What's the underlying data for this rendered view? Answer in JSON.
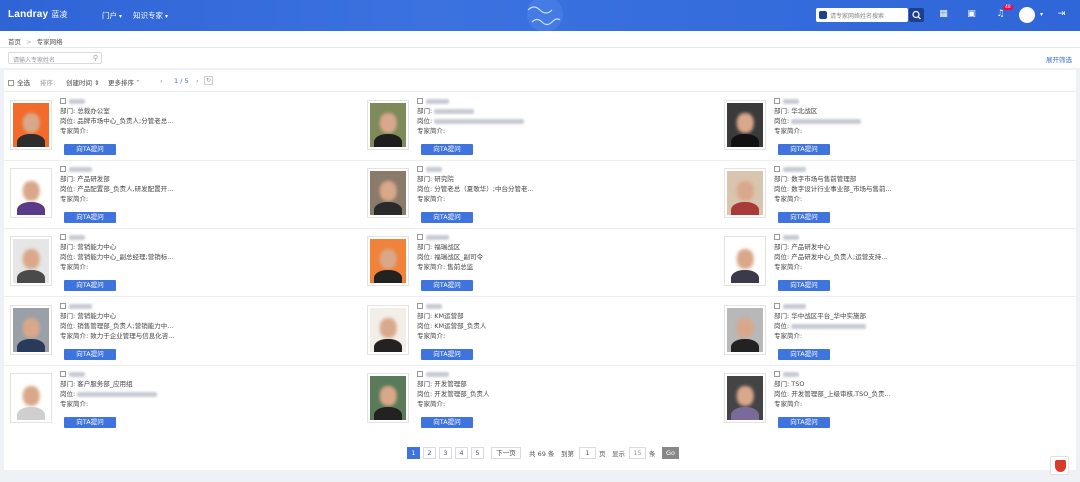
{
  "header": {
    "brand": "Landray",
    "brand_cn": "蓝凌",
    "nav": [
      {
        "label": "门户"
      },
      {
        "label": "知识专家"
      }
    ],
    "search_placeholder": "请专家网络姓名搜索",
    "notification_count": "48",
    "colors": {
      "primary": "#2f64d6",
      "button": "#3f73de"
    }
  },
  "breadcrumb": {
    "home": "首页",
    "sep": ">",
    "current": "专家网络"
  },
  "filter": {
    "search_placeholder": "请输入专家姓名",
    "expand_label": "展开筛选"
  },
  "toolbar": {
    "select_all": "全选",
    "sort_label": "排序:",
    "sort_created": "创建时间 ⇕",
    "more_sort": "更多排序",
    "page_indicator": "1 / 5"
  },
  "labels": {
    "dept": "部门:",
    "post": "岗位:",
    "intro": "专家简介:",
    "ask": "向TA提问"
  },
  "experts": [
    {
      "dept": "总裁办公室",
      "post": "品牌市场中心_负责人;分管老总...",
      "intro": ""
    },
    {
      "dept": "",
      "post": "",
      "intro": ""
    },
    {
      "dept": "华北战区",
      "post": "",
      "intro": ""
    },
    {
      "dept": "产品研发部",
      "post": "产品配置部_负责人,研发配置开...",
      "intro": ""
    },
    {
      "dept": "研究院",
      "post": "分管老总（夏歌华）;中台分管老...",
      "intro": ""
    },
    {
      "dept": "数字市场与售前管理部",
      "post": "数字设计行业事业部_市场与售前...",
      "intro": ""
    },
    {
      "dept": "营销能力中心",
      "post": "营销能力中心_副总经理;营销标...",
      "intro": ""
    },
    {
      "dept": "福瑞战区",
      "post": "福瑞战区_副司令",
      "intro": "售前总监"
    },
    {
      "dept": "产品研发中心",
      "post": "产品研发中心_负责人;运营支持...",
      "intro": ""
    },
    {
      "dept": "营销能力中心",
      "post": "销售管理部_负责人;营销能力中...",
      "intro": "致力于企业管理与信息化咨..."
    },
    {
      "dept": "KM运营部",
      "post": "KM运营部_负责人",
      "intro": ""
    },
    {
      "dept": "华中战区平台_华中实施部",
      "post": "",
      "intro": ""
    },
    {
      "dept": "客户服务部_应用组",
      "post": "",
      "intro": ""
    },
    {
      "dept": "开发管理部",
      "post": "开发管理部_负责人",
      "intro": ""
    },
    {
      "dept": "TSO",
      "post": "开发管理部_上级审核,TSO_负责...",
      "intro": ""
    }
  ],
  "pagination": {
    "pages": [
      "1",
      "2",
      "3",
      "4",
      "5"
    ],
    "next": "下一页",
    "total": "共 69 条",
    "goto": "到第",
    "goto_value": "1",
    "page_unit": "页",
    "show": "显示",
    "show_value": "15",
    "item_unit": "条",
    "go": "Go"
  }
}
